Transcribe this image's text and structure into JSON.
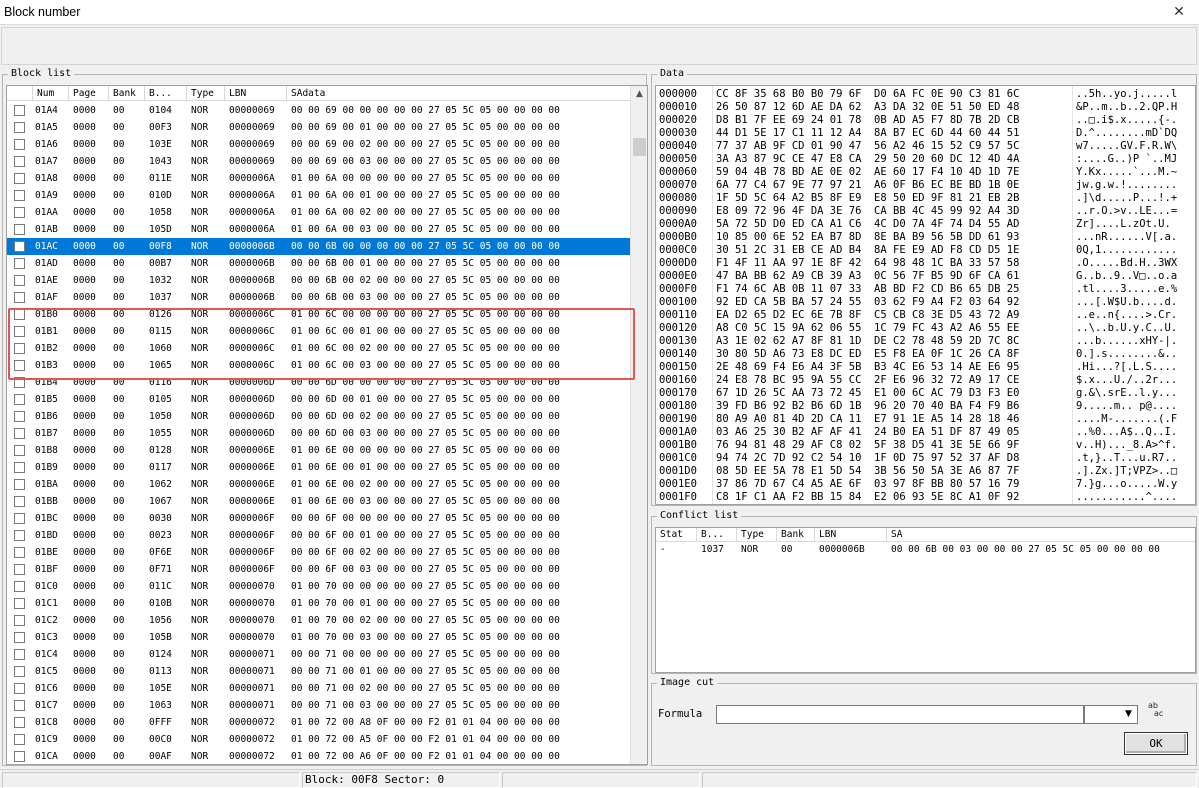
{
  "window": {
    "title": "Block number",
    "close_glyph": "✕"
  },
  "block_list": {
    "label": "Block list",
    "columns": [
      "Num",
      "Page",
      "Bank",
      "B...",
      "Type",
      "LBN",
      "SAdata"
    ],
    "scroll_up": "▲",
    "rows": [
      [
        "01A4",
        "0000",
        "00",
        "0104",
        "NOR",
        "00000069",
        "00 00 69 00 00 00 00 00 27 05 5C 05 00 00 00 00"
      ],
      [
        "01A5",
        "0000",
        "00",
        "00F3",
        "NOR",
        "00000069",
        "00 00 69 00 01 00 00 00 27 05 5C 05 00 00 00 00"
      ],
      [
        "01A6",
        "0000",
        "00",
        "103E",
        "NOR",
        "00000069",
        "00 00 69 00 02 00 00 00 27 05 5C 05 00 00 00 00"
      ],
      [
        "01A7",
        "0000",
        "00",
        "1043",
        "NOR",
        "00000069",
        "00 00 69 00 03 00 00 00 27 05 5C 05 00 00 00 00"
      ],
      [
        "01A8",
        "0000",
        "00",
        "011E",
        "NOR",
        "0000006A",
        "01 00 6A 00 00 00 00 00 27 05 5C 05 00 00 00 00"
      ],
      [
        "01A9",
        "0000",
        "00",
        "010D",
        "NOR",
        "0000006A",
        "01 00 6A 00 01 00 00 00 27 05 5C 05 00 00 00 00"
      ],
      [
        "01AA",
        "0000",
        "00",
        "1058",
        "NOR",
        "0000006A",
        "01 00 6A 00 02 00 00 00 27 05 5C 05 00 00 00 00"
      ],
      [
        "01AB",
        "0000",
        "00",
        "105D",
        "NOR",
        "0000006A",
        "01 00 6A 00 03 00 00 00 27 05 5C 05 00 00 00 00"
      ],
      [
        "01AC",
        "0000",
        "00",
        "00F8",
        "NOR",
        "0000006B",
        "00 00 6B 00 00 00 00 00 27 05 5C 05 00 00 00 00"
      ],
      [
        "01AD",
        "0000",
        "00",
        "00B7",
        "NOR",
        "0000006B",
        "00 00 6B 00 01 00 00 00 27 05 5C 05 00 00 00 00"
      ],
      [
        "01AE",
        "0000",
        "00",
        "1032",
        "NOR",
        "0000006B",
        "00 00 6B 00 02 00 00 00 27 05 5C 05 00 00 00 00"
      ],
      [
        "01AF",
        "0000",
        "00",
        "1037",
        "NOR",
        "0000006B",
        "00 00 6B 00 03 00 00 00 27 05 5C 05 00 00 00 00"
      ],
      [
        "01B0",
        "0000",
        "00",
        "0126",
        "NOR",
        "0000006C",
        "01 00 6C 00 00 00 00 00 27 05 5C 05 00 00 00 00"
      ],
      [
        "01B1",
        "0000",
        "00",
        "0115",
        "NOR",
        "0000006C",
        "01 00 6C 00 01 00 00 00 27 05 5C 05 00 00 00 00"
      ],
      [
        "01B2",
        "0000",
        "00",
        "1060",
        "NOR",
        "0000006C",
        "01 00 6C 00 02 00 00 00 27 05 5C 05 00 00 00 00"
      ],
      [
        "01B3",
        "0000",
        "00",
        "1065",
        "NOR",
        "0000006C",
        "01 00 6C 00 03 00 00 00 27 05 5C 05 00 00 00 00"
      ],
      [
        "01B4",
        "0000",
        "00",
        "0116",
        "NOR",
        "0000006D",
        "00 00 6D 00 00 00 00 00 27 05 5C 05 00 00 00 00"
      ],
      [
        "01B5",
        "0000",
        "00",
        "0105",
        "NOR",
        "0000006D",
        "00 00 6D 00 01 00 00 00 27 05 5C 05 00 00 00 00"
      ],
      [
        "01B6",
        "0000",
        "00",
        "1050",
        "NOR",
        "0000006D",
        "00 00 6D 00 02 00 00 00 27 05 5C 05 00 00 00 00"
      ],
      [
        "01B7",
        "0000",
        "00",
        "1055",
        "NOR",
        "0000006D",
        "00 00 6D 00 03 00 00 00 27 05 5C 05 00 00 00 00"
      ],
      [
        "01B8",
        "0000",
        "00",
        "0128",
        "NOR",
        "0000006E",
        "01 00 6E 00 00 00 00 00 27 05 5C 05 00 00 00 00"
      ],
      [
        "01B9",
        "0000",
        "00",
        "0117",
        "NOR",
        "0000006E",
        "01 00 6E 00 01 00 00 00 27 05 5C 05 00 00 00 00"
      ],
      [
        "01BA",
        "0000",
        "00",
        "1062",
        "NOR",
        "0000006E",
        "01 00 6E 00 02 00 00 00 27 05 5C 05 00 00 00 00"
      ],
      [
        "01BB",
        "0000",
        "00",
        "1067",
        "NOR",
        "0000006E",
        "01 00 6E 00 03 00 00 00 27 05 5C 05 00 00 00 00"
      ],
      [
        "01BC",
        "0000",
        "00",
        "0030",
        "NOR",
        "0000006F",
        "00 00 6F 00 00 00 00 00 27 05 5C 05 00 00 00 00"
      ],
      [
        "01BD",
        "0000",
        "00",
        "0023",
        "NOR",
        "0000006F",
        "00 00 6F 00 01 00 00 00 27 05 5C 05 00 00 00 00"
      ],
      [
        "01BE",
        "0000",
        "00",
        "0F6E",
        "NOR",
        "0000006F",
        "00 00 6F 00 02 00 00 00 27 05 5C 05 00 00 00 00"
      ],
      [
        "01BF",
        "0000",
        "00",
        "0F71",
        "NOR",
        "0000006F",
        "00 00 6F 00 03 00 00 00 27 05 5C 05 00 00 00 00"
      ],
      [
        "01C0",
        "0000",
        "00",
        "011C",
        "NOR",
        "00000070",
        "01 00 70 00 00 00 00 00 27 05 5C 05 00 00 00 00"
      ],
      [
        "01C1",
        "0000",
        "00",
        "010B",
        "NOR",
        "00000070",
        "01 00 70 00 01 00 00 00 27 05 5C 05 00 00 00 00"
      ],
      [
        "01C2",
        "0000",
        "00",
        "1056",
        "NOR",
        "00000070",
        "01 00 70 00 02 00 00 00 27 05 5C 05 00 00 00 00"
      ],
      [
        "01C3",
        "0000",
        "00",
        "105B",
        "NOR",
        "00000070",
        "01 00 70 00 03 00 00 00 27 05 5C 05 00 00 00 00"
      ],
      [
        "01C4",
        "0000",
        "00",
        "0124",
        "NOR",
        "00000071",
        "00 00 71 00 00 00 00 00 27 05 5C 05 00 00 00 00"
      ],
      [
        "01C5",
        "0000",
        "00",
        "0113",
        "NOR",
        "00000071",
        "00 00 71 00 01 00 00 00 27 05 5C 05 00 00 00 00"
      ],
      [
        "01C6",
        "0000",
        "00",
        "105E",
        "NOR",
        "00000071",
        "00 00 71 00 02 00 00 00 27 05 5C 05 00 00 00 00"
      ],
      [
        "01C7",
        "0000",
        "00",
        "1063",
        "NOR",
        "00000071",
        "00 00 71 00 03 00 00 00 27 05 5C 05 00 00 00 00"
      ],
      [
        "01C8",
        "0000",
        "00",
        "0FFF",
        "NOR",
        "00000072",
        "01 00 72 00 A8 0F 00 00 F2 01 01 04 00 00 00 00"
      ],
      [
        "01C9",
        "0000",
        "00",
        "00C0",
        "NOR",
        "00000072",
        "01 00 72 00 A5 0F 00 00 F2 01 01 04 00 00 00 00"
      ],
      [
        "01CA",
        "0000",
        "00",
        "00AF",
        "NOR",
        "00000072",
        "01 00 72 00 A6 0F 00 00 F2 01 01 04 00 00 00 00"
      ]
    ]
  },
  "data": {
    "label": "Data",
    "lines": [
      {
        "off": "000000",
        "hex": "CC 8F 35 68 B0 B0 79 6F  D0 6A FC 0E 90 C3 81 6C",
        "asc": "..5h..yo.j.....l"
      },
      {
        "off": "000010",
        "hex": "26 50 87 12 6D AE DA 62  A3 DA 32 0E 51 50 ED 48",
        "asc": "&P..m..b..2.QP.H"
      },
      {
        "off": "000020",
        "hex": "D8 B1 7F EE 69 24 01 78  0B AD A5 F7 8D 7B 2D CB",
        "asc": "..□.i$.x.....{-."
      },
      {
        "off": "000030",
        "hex": "44 D1 5E 17 C1 11 12 A4  8A B7 EC 6D 44 60 44 51",
        "asc": "D.^........mD`DQ"
      },
      {
        "off": "000040",
        "hex": "77 37 AB 9F CD 01 90 47  56 A2 46 15 52 C9 57 5C",
        "asc": "w7.....GV.F.R.W\\"
      },
      {
        "off": "000050",
        "hex": "3A A3 87 9C CE 47 E8 CA  29 50 20 60 DC 12 4D 4A",
        "asc": ":....G..)P `..MJ"
      },
      {
        "off": "000060",
        "hex": "59 04 4B 78 BD AE 0E 02  AE 60 17 F4 10 4D 1D 7E",
        "asc": "Y.Kx.....`...M.~"
      },
      {
        "off": "000070",
        "hex": "6A 77 C4 67 9E 77 97 21  A6 0F B6 EC BE BD 1B 0E",
        "asc": "jw.g.w.!........"
      },
      {
        "off": "000080",
        "hex": "1F 5D 5C 64 A2 B5 8F E9  E8 50 ED 9F 81 21 EB 2B",
        "asc": ".]\\d.....P...!.+"
      },
      {
        "off": "000090",
        "hex": "E8 09 72 96 4F DA 3E 76  CA BB 4C 45 99 92 A4 3D",
        "asc": "..r.O.>v..LE...="
      },
      {
        "off": "0000A0",
        "hex": "5A 72 5D D0 ED CA A1 C6  4C D0 7A 4F 74 D4 55 AD",
        "asc": "Zr]....L.zOt.U."
      },
      {
        "off": "0000B0",
        "hex": "10 85 00 6E 52 EA B7 8D  8E BA B9 56 5B DD 61 93",
        "asc": "...nR......V[.a."
      },
      {
        "off": "0000C0",
        "hex": "30 51 2C 31 EB CE AD B4  8A FE E9 AD F8 CD D5 1E",
        "asc": "0Q,1............"
      },
      {
        "off": "0000D0",
        "hex": "F1 4F 11 AA 97 1E 8F 42  64 98 48 1C BA 33 57 58",
        "asc": ".O.....Bd.H..3WX"
      },
      {
        "off": "0000E0",
        "hex": "47 BA BB 62 A9 CB 39 A3  0C 56 7F B5 9D 6F CA 61",
        "asc": "G..b..9..V□..o.a"
      },
      {
        "off": "0000F0",
        "hex": "F1 74 6C AB 0B 11 07 33  AB BD F2 CD B6 65 DB 25",
        "asc": ".tl....3.....e.%"
      },
      {
        "off": "000100",
        "hex": "92 ED CA 5B BA 57 24 55  03 62 F9 A4 F2 03 64 92",
        "asc": "...[.W$U.b....d."
      },
      {
        "off": "000110",
        "hex": "EA D2 65 D2 EC 6E 7B 8F  C5 CB C8 3E D5 43 72 A9",
        "asc": "..e..n{....>.Cr."
      },
      {
        "off": "000120",
        "hex": "A8 C0 5C 15 9A 62 06 55  1C 79 FC 43 A2 A6 55 EE",
        "asc": "..\\..b.U.y.C..U."
      },
      {
        "off": "000130",
        "hex": "A3 1E 02 62 A7 8F 81 1D  DE C2 78 48 59 2D 7C 8C",
        "asc": "...b......xHY-|."
      },
      {
        "off": "000140",
        "hex": "30 80 5D A6 73 E8 DC ED  E5 F8 EA 0F 1C 26 CA 8F",
        "asc": "0.].s........&.."
      },
      {
        "off": "000150",
        "hex": "2E 48 69 F4 E6 A4 3F 5B  B3 4C E6 53 14 AE E6 95",
        "asc": ".Hi...?[.L.S...."
      },
      {
        "off": "000160",
        "hex": "24 E8 78 BC 95 9A 55 CC  2F E6 96 32 72 A9 17 CE",
        "asc": "$.x...U./..2r..."
      },
      {
        "off": "000170",
        "hex": "67 1D 26 5C AA 73 72 45  E1 00 6C AC 79 D3 F3 E0",
        "asc": "g.&\\.srE..l.y..."
      },
      {
        "off": "000180",
        "hex": "39 FD B6 92 B2 B6 6D 1B  96 20 70 40 BA F4 F9 B6",
        "asc": "9.....m.. p@...."
      },
      {
        "off": "000190",
        "hex": "80 A9 A0 81 4D 2D CA 11  E7 91 1E A5 14 28 18 46",
        "asc": "....M-.......(.F"
      },
      {
        "off": "0001A0",
        "hex": "03 A6 25 30 B2 AF AF 41  24 B0 EA 51 DF 87 49 05",
        "asc": "..%0...A$..Q..I."
      },
      {
        "off": "0001B0",
        "hex": "76 94 81 48 29 AF C8 02  5F 38 D5 41 3E 5E 66 9F",
        "asc": "v..H)..._8.A>^f."
      },
      {
        "off": "0001C0",
        "hex": "94 74 2C 7D 92 C2 54 10  1F 0D 75 97 52 37 AF D8",
        "asc": ".t,}..T...u.R7.."
      },
      {
        "off": "0001D0",
        "hex": "08 5D EE 5A 78 E1 5D 54  3B 56 50 5A 3E A6 87 7F",
        "asc": ".].Zx.]T;VPZ>..□"
      },
      {
        "off": "0001E0",
        "hex": "37 86 7D 67 C4 A5 AE 6F  03 97 8F BB 80 57 16 79",
        "asc": "7.}g...o.....W.y"
      },
      {
        "off": "0001F0",
        "hex": "C8 1F C1 AA F2 BB 15 84  E2 06 93 5E 8C A1 0F 92",
        "asc": "...........^...."
      }
    ]
  },
  "conflict_list": {
    "label": "Conflict list",
    "columns": [
      "Stat",
      "B...",
      "Type",
      "Bank",
      "LBN",
      "SA"
    ],
    "rows": [
      [
        "-",
        "1037",
        "NOR",
        "00",
        "0000006B",
        "00 00 6B 00 03 00 00 00 27 05 5C 05 00 00 00 00"
      ]
    ]
  },
  "image_cut": {
    "label": "Image cut",
    "formula_label": "Formula",
    "formula_value": "",
    "select_value": "",
    "dropdown_glyph": "▼",
    "abc_top": "ab",
    "abc_bottom": "ac",
    "ok_label": "OK"
  },
  "statusbar": {
    "block_sector": "Block: 00F8 Sector: 0"
  },
  "colors": {
    "selection": "#0078d7",
    "highlight_box": "#e05555"
  }
}
